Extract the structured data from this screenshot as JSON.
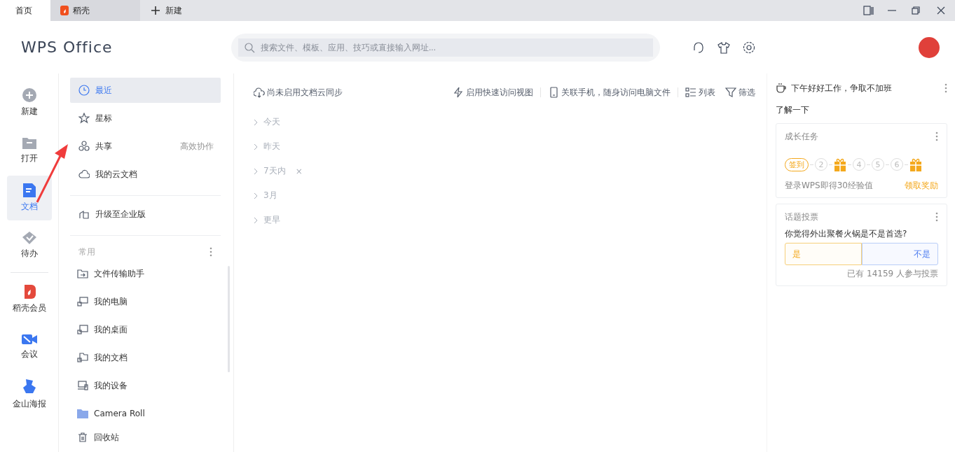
{
  "tabs": [
    {
      "label": "首页",
      "selected": true,
      "kind": "home"
    },
    {
      "label": "稻壳",
      "selected": false,
      "kind": "docer"
    }
  ],
  "new_tab": {
    "label": "新建"
  },
  "logo": "WPS Office",
  "search": {
    "placeholder": "搜索文件、模板、应用、技巧或直接输入网址..."
  },
  "rail": [
    {
      "label": "新建",
      "selected": false,
      "kind": "plus"
    },
    {
      "label": "打开",
      "selected": false,
      "kind": "folder"
    },
    {
      "label": "文档",
      "selected": true,
      "kind": "doc"
    },
    {
      "label": "待办",
      "selected": false,
      "kind": "todo"
    },
    {
      "label": "稻壳会员",
      "selected": false,
      "kind": "docer"
    },
    {
      "label": "会议",
      "selected": false,
      "kind": "meeting"
    },
    {
      "label": "金山海报",
      "selected": false,
      "kind": "poster"
    }
  ],
  "nav": [
    {
      "label": "最近",
      "selected": true,
      "kind": "clock"
    },
    {
      "label": "星标",
      "selected": false,
      "kind": "star"
    },
    {
      "label": "共享",
      "selected": false,
      "kind": "share",
      "hint": "高效协作"
    },
    {
      "label": "我的云文档",
      "selected": false,
      "kind": "cloud"
    }
  ],
  "upgrade": {
    "label": "升级至企业版"
  },
  "common": {
    "title": "常用",
    "items": [
      {
        "label": "文件传输助手",
        "kind": "transfer"
      },
      {
        "label": "我的电脑",
        "kind": "pc"
      },
      {
        "label": "我的桌面",
        "kind": "desk"
      },
      {
        "label": "我的文档",
        "kind": "docs"
      },
      {
        "label": "我的设备",
        "kind": "device"
      },
      {
        "label": "Camera Roll",
        "kind": "folder"
      }
    ]
  },
  "trash": {
    "label": "回收站"
  },
  "toolbar": {
    "sync": "尚未启用文档云同步",
    "quick": "启用快速访问视图",
    "phone": "关联手机，随身访问电脑文件",
    "list": "列表",
    "filter": "筛选"
  },
  "groups": [
    {
      "label": "今天"
    },
    {
      "label": "昨天"
    },
    {
      "label": "7天内",
      "remove": "×"
    },
    {
      "label": "3月"
    },
    {
      "label": "更早"
    }
  ],
  "greeting": "下午好好工作，争取不加班",
  "learn": "了解一下",
  "task_card": {
    "title": "成长任务",
    "steps": [
      {
        "kind": "checkin",
        "label": "签到"
      },
      {
        "kind": "number",
        "label": "2"
      },
      {
        "kind": "gift"
      },
      {
        "kind": "number",
        "label": "4"
      },
      {
        "kind": "number",
        "label": "5"
      },
      {
        "kind": "number",
        "label": "6"
      },
      {
        "kind": "gift"
      }
    ],
    "note": "登录WPS即得30经验值",
    "action": "领取奖励"
  },
  "vote_card": {
    "title": "话题投票",
    "question": "你觉得外出聚餐火锅是不是首选?",
    "yes": "是",
    "no": "不是",
    "count": "已有 14159 人参与投票"
  }
}
